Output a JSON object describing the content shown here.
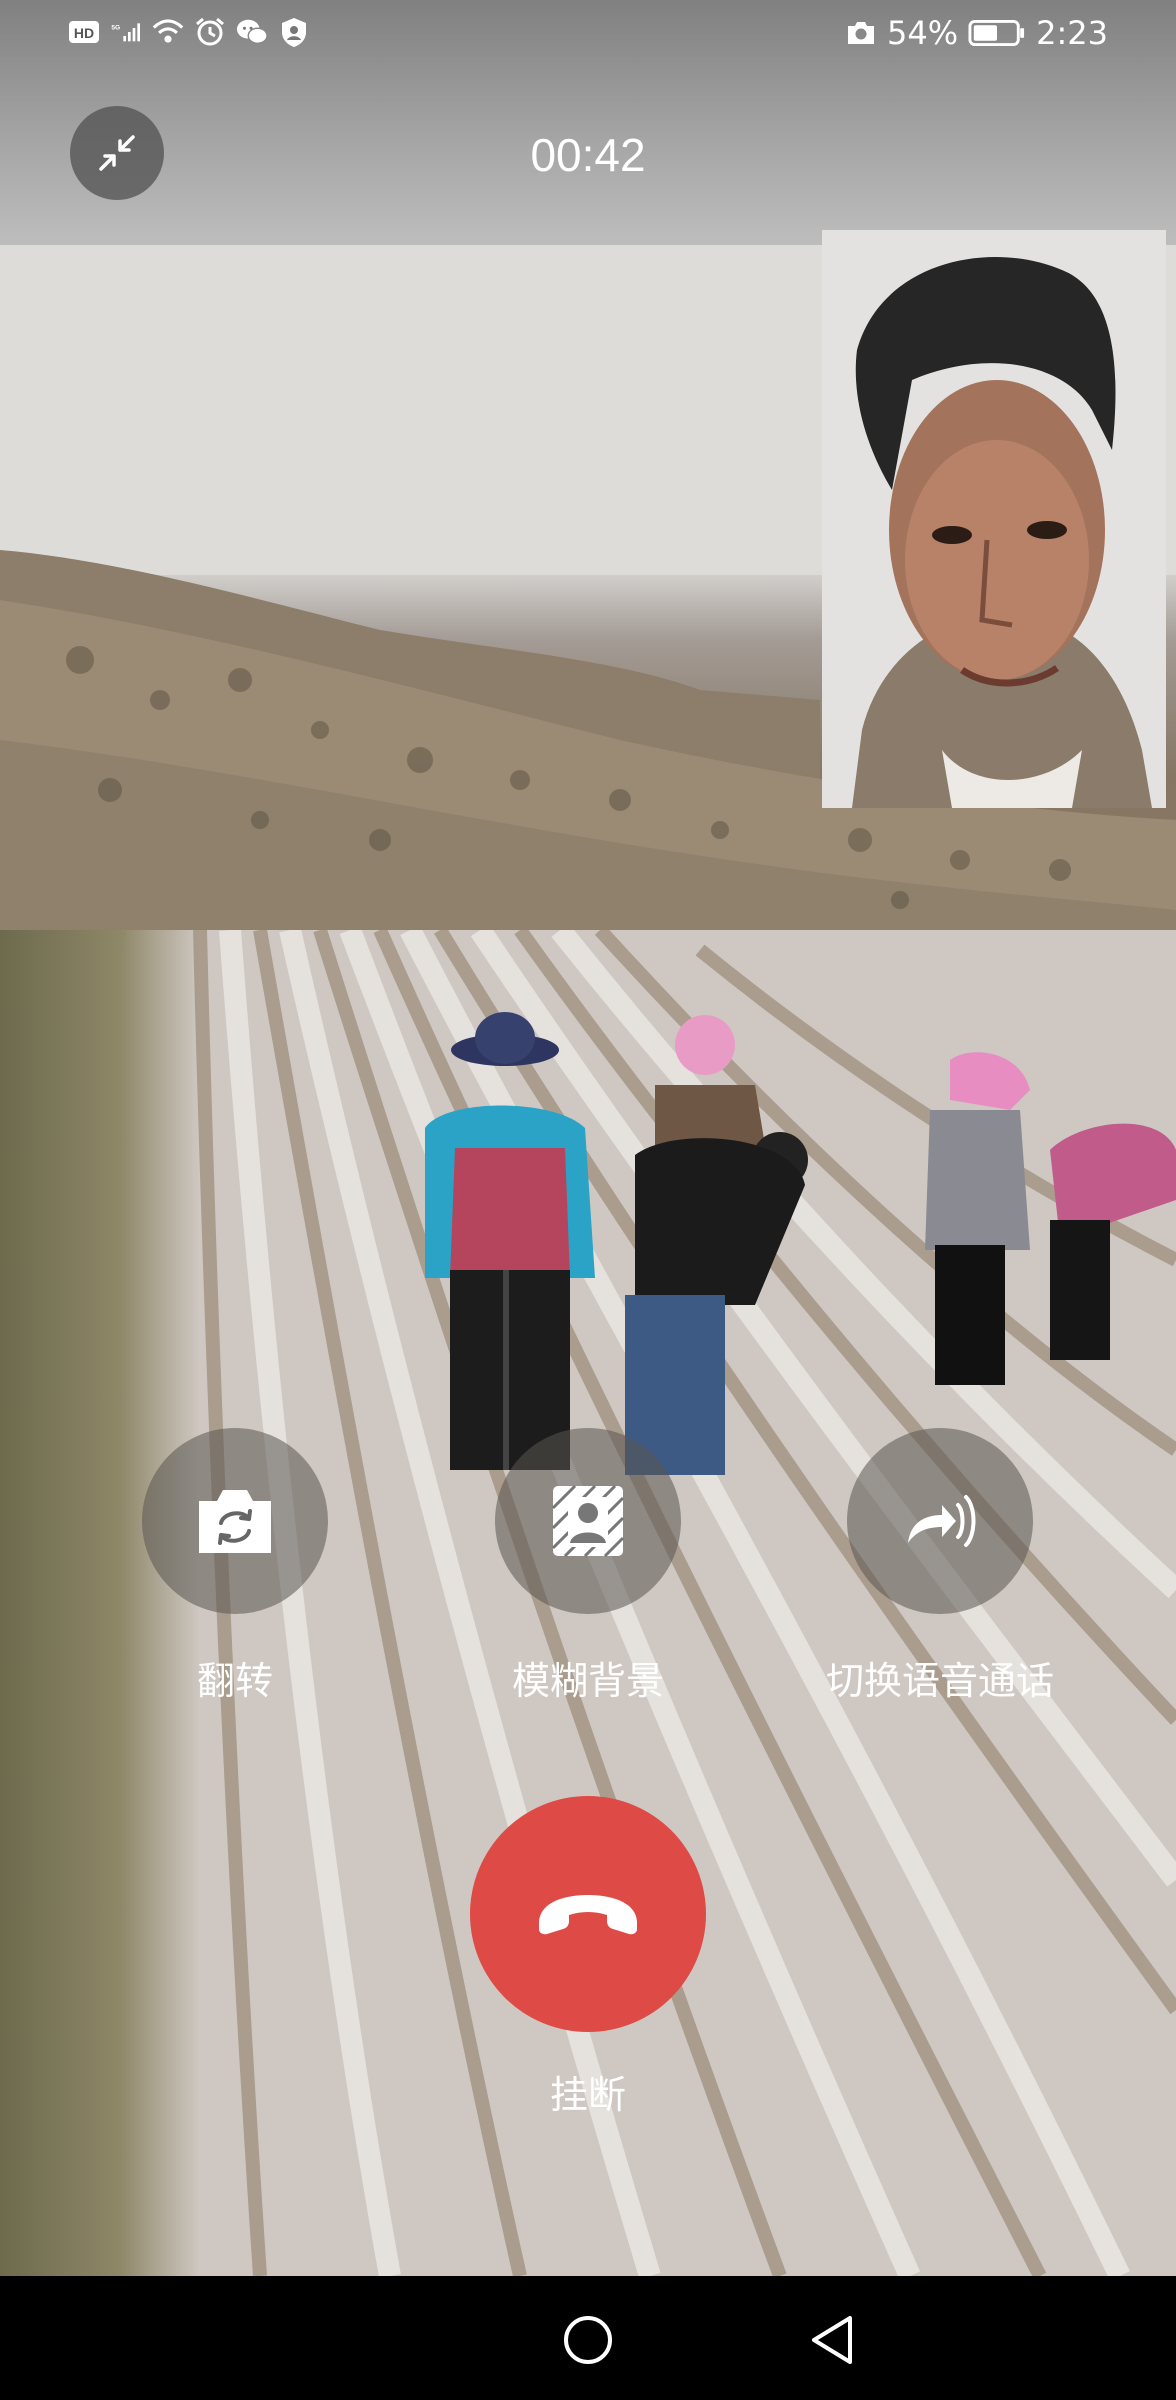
{
  "status_bar": {
    "battery_percent": "54%",
    "time": "2:23",
    "left_icons": [
      "hd-icon",
      "5g-signal-icon",
      "wifi-icon",
      "alarm-icon",
      "wechat-icon",
      "shield-icon"
    ],
    "right_icons": [
      "camera-icon",
      "battery-icon"
    ]
  },
  "call": {
    "duration": "00:42"
  },
  "controls": {
    "flip_label": "翻转",
    "blur_label": "模糊背景",
    "voice_label": "切换语音通话",
    "hangup_label": "挂断"
  },
  "colors": {
    "hangup": "#de4b47",
    "control_bg": "rgba(90,85,80,0.55)"
  }
}
